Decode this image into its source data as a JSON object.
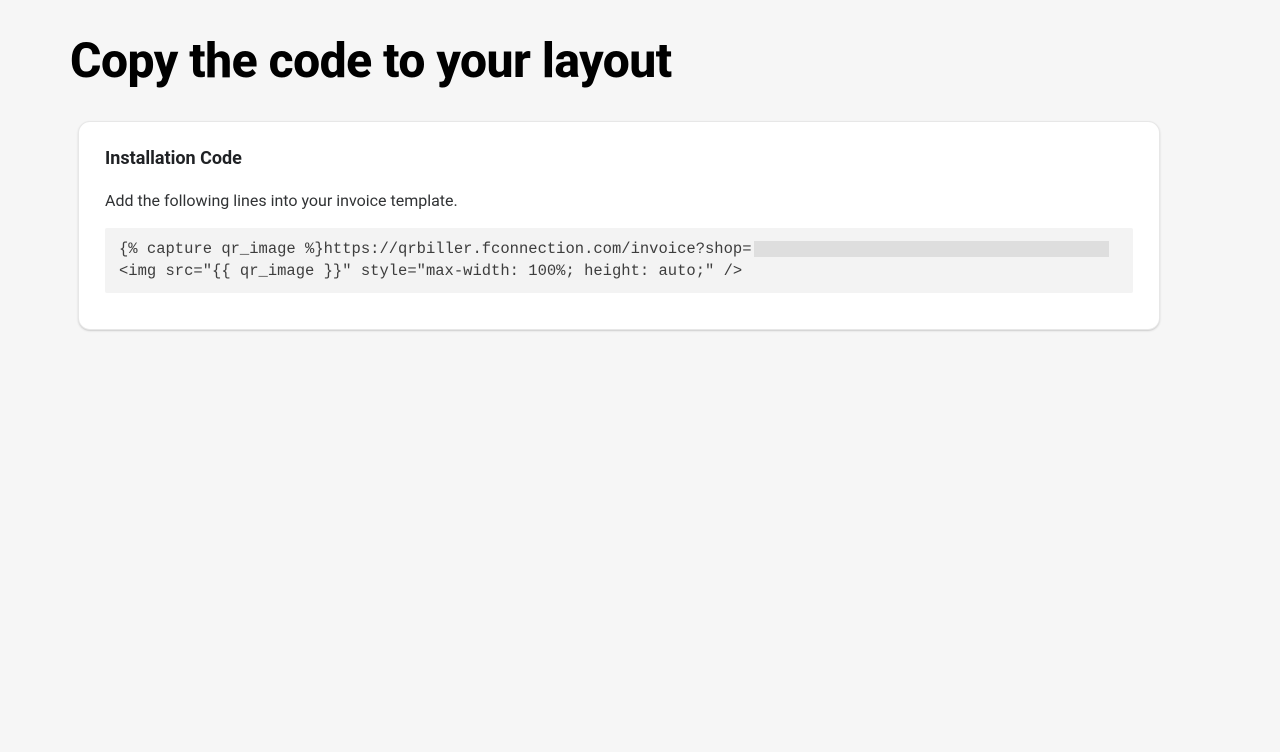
{
  "heading": "Copy the code to your layout",
  "card": {
    "title": "Installation Code",
    "instruction": "Add the following lines into your invoice template.",
    "code_line1_visible": "{% capture qr_image %}https://qrbiller.fconnection.com/invoice?shop=",
    "code_line2": "<img src=\"{{ qr_image }}\" style=\"max-width: 100%; height: auto;\" />"
  }
}
